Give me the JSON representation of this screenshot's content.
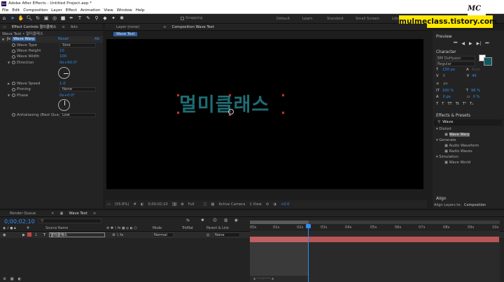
{
  "window_title": "Adobe After Effects - Untitled Project.aep *",
  "menu": [
    "File",
    "Edit",
    "Composition",
    "Layer",
    "Effect",
    "Animation",
    "View",
    "Window",
    "Help"
  ],
  "toolbar": {
    "snapping_label": "Snapping",
    "workspaces": [
      "Default",
      "Learn",
      "Standard",
      "Small Screen",
      "Library"
    ]
  },
  "watermark": {
    "text": "mulmeclass.tistory.com",
    "logo": "MC"
  },
  "effect_controls": {
    "tab_label": "Effect Controls 멀미클래스",
    "tab2": "Ado",
    "layer_path": "Wave Text • 멀미클래스",
    "effect_name": "Wave Warp",
    "reset_label": "Reset",
    "about_label": "Ab",
    "properties": [
      {
        "name": "Wave Type",
        "value": "Sine"
      },
      {
        "name": "Wave Height",
        "value": "10"
      },
      {
        "name": "Wave Width",
        "value": "100"
      },
      {
        "name": "Direction",
        "value": "0x+90.0°"
      },
      {
        "name": "Wave Speed",
        "value": "1.0"
      },
      {
        "name": "Pinning",
        "value": "None"
      },
      {
        "name": "Phase",
        "value": "0x+0.0°"
      },
      {
        "name": "Antialiasing (Best Qua",
        "value": "Low"
      }
    ]
  },
  "layer_panel": {
    "tab_label": "Layer (none)"
  },
  "composition": {
    "tab_label": "Composition Wave Text",
    "sub_tab": "Wave Text",
    "text": "멀미클래스",
    "text_color": "#1f6c73",
    "footer": {
      "zoom": "(55.8%)",
      "timecode": "0;00;02;10",
      "resolution": "Full",
      "camera": "Active Camera",
      "views": "1 View",
      "exposure": "+0.0"
    }
  },
  "right_panel": {
    "preview_title": "Preview",
    "character_title": "Character",
    "font_name": "BM DoHyeon",
    "font_style": "Regular",
    "font_size": "150 px",
    "leading": "Auto",
    "kerning": "0",
    "tracking": "40",
    "stroke_unit": "px",
    "vert_scale": "100 %",
    "horiz_scale": "99 %",
    "baseline": "0 px",
    "tsume": "0 %",
    "fill_color": "#0f5a60",
    "effects_presets_title": "Effects & Presets",
    "search_value": "Wave",
    "tree": [
      {
        "label": "Distort",
        "type": "folder"
      },
      {
        "label": "Wave Warp",
        "type": "item",
        "selected": true
      },
      {
        "label": "Generate",
        "type": "folder"
      },
      {
        "label": "Audio Waveform",
        "type": "item"
      },
      {
        "label": "Radio Waves",
        "type": "item"
      },
      {
        "label": "Simulation",
        "type": "folder"
      },
      {
        "label": "Wave World",
        "type": "item"
      }
    ],
    "align_title": "Align",
    "align_layers_to": "Align Layers to:",
    "align_target": "Composition"
  },
  "timeline": {
    "render_queue_tab": "Render Queue",
    "comp_tab": "Wave Text",
    "timecode": "0;00;02;10",
    "columns": {
      "source_name": "Source Name",
      "mode": "Mode",
      "trkmat": "TrkMat",
      "parent": "Parent & Link"
    },
    "layer": {
      "number": "1",
      "name": "멀미클래스",
      "mode": "Normal",
      "parent": "None"
    },
    "ruler_labels": [
      "00s",
      "01s",
      "02s",
      "03s",
      "04s",
      "05s",
      "06s",
      "07s",
      "08s",
      "09s",
      "10s"
    ],
    "playhead_position_seconds": 2.33,
    "accent_color": "#2f8df5",
    "layer_bar_color": "#b85555"
  }
}
